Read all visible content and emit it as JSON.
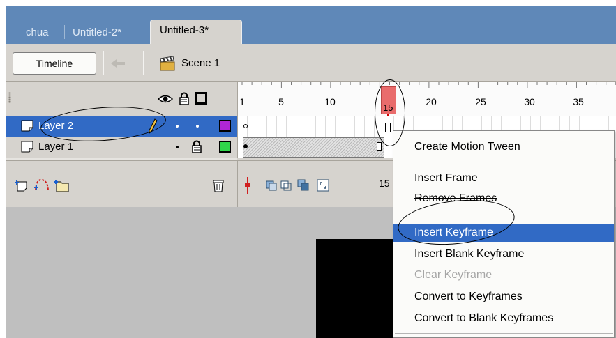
{
  "doc_tabs": [
    {
      "label": "chua",
      "active": false
    },
    {
      "label": "Untitled-2*",
      "active": false
    },
    {
      "label": "Untitled-3*",
      "active": true
    }
  ],
  "editbar": {
    "timeline_label": "Timeline",
    "back_icon": "back-arrow-icon",
    "scene_icon": "clapperboard-icon",
    "scene_label": "Scene 1"
  },
  "layer_header_icons": [
    "eye-icon",
    "lock-icon",
    "outline-icon"
  ],
  "ruler": {
    "labels": [
      "1",
      "5",
      "10",
      "15",
      "20",
      "25",
      "30",
      "35"
    ],
    "current_frame": "15"
  },
  "layers": [
    {
      "name": "Layer 2",
      "selected": true,
      "outline_color": "#b026d6",
      "icons": [
        "layer-icon",
        "pencil-icon"
      ]
    },
    {
      "name": "Layer 1",
      "selected": false,
      "outline_color": "#30d64a",
      "icons": [
        "layer-icon",
        "lock-icon"
      ]
    }
  ],
  "timeline_footer": {
    "left_icons": [
      "add-layer-icon",
      "add-motion-guide-icon",
      "add-folder-icon"
    ],
    "trash_icon": "trash-icon",
    "frame_tools": [
      "center-frame-icon",
      "onion-skin-icon",
      "onion-skin-outlines-icon",
      "edit-multiple-frames-icon",
      "modify-onion-markers-icon"
    ],
    "current_frame_display": "15"
  },
  "context_menu": {
    "items": [
      {
        "label": "Create Motion Tween",
        "state": "normal"
      },
      {
        "label": "Insert Frame",
        "state": "normal"
      },
      {
        "label": "Remove Frames",
        "state": "normal"
      },
      {
        "label": "Insert Keyframe",
        "state": "highlighted"
      },
      {
        "label": "Insert Blank Keyframe",
        "state": "normal"
      },
      {
        "label": "Clear Keyframe",
        "state": "disabled"
      },
      {
        "label": "Convert to Keyframes",
        "state": "normal"
      },
      {
        "label": "Convert to Blank Keyframes",
        "state": "normal"
      }
    ]
  },
  "colors": {
    "tab_bar": "#5f88b8",
    "selection": "#316ac5",
    "playhead": "#e96c6c"
  }
}
